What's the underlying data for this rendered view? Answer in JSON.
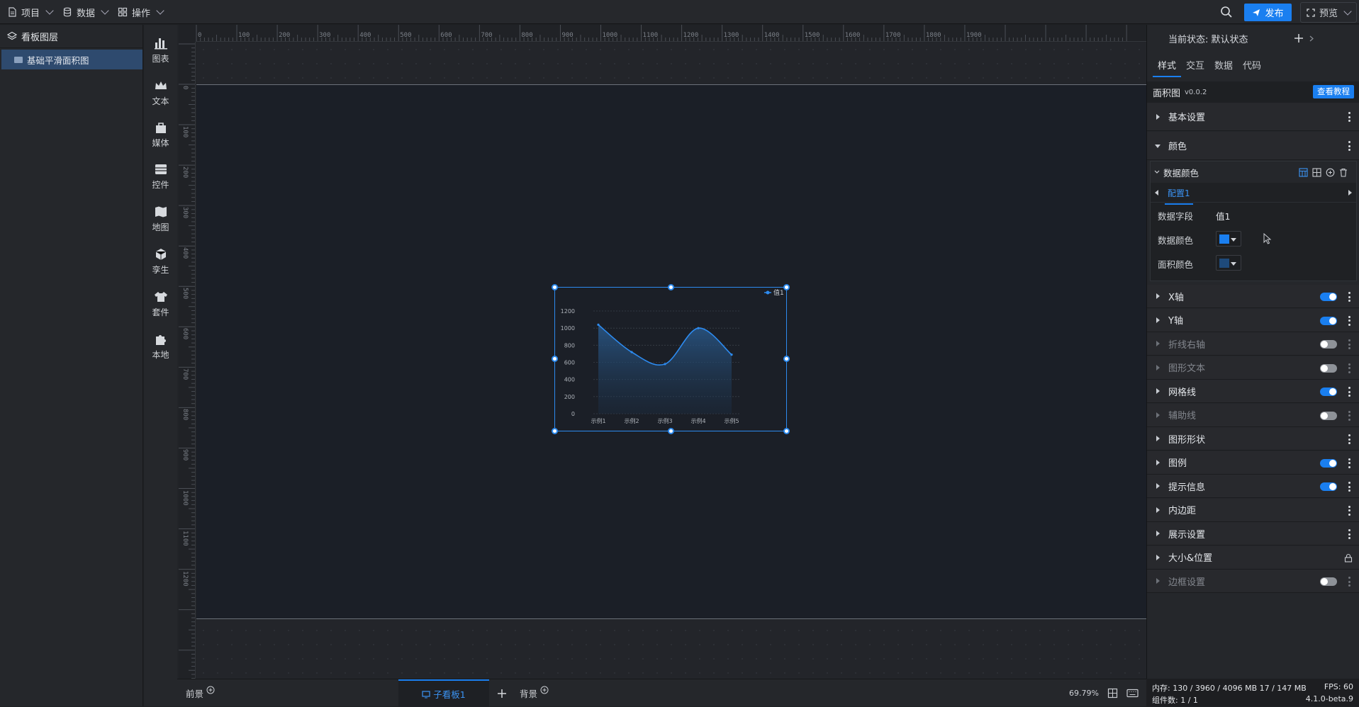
{
  "topbar": {
    "menus": [
      "项目",
      "数据",
      "操作"
    ],
    "publish_label": "发布",
    "preview_label": "预览"
  },
  "layers": {
    "title": "看板图层",
    "items": [
      "基础平滑面积图"
    ]
  },
  "toolbox": [
    "图表",
    "文本",
    "媒体",
    "控件",
    "地图",
    "孪生",
    "套件",
    "本地"
  ],
  "ruler": {
    "top": [
      "0",
      "100",
      "200",
      "300",
      "400",
      "500",
      "600",
      "700",
      "800",
      "900",
      "1000",
      "1100",
      "1200",
      "1300",
      "1400",
      "1500",
      "1600",
      "1700",
      "1800",
      "1900"
    ],
    "left": [
      "0",
      "100",
      "200",
      "300",
      "400",
      "500",
      "600",
      "700",
      "800",
      "900",
      "1000",
      "1100",
      "1200"
    ]
  },
  "bottom": {
    "tabs": [
      "前景",
      "子看板1",
      "背景"
    ],
    "zoom": "69.79%"
  },
  "panel": {
    "state_label": "当前状态: 默认状态",
    "tabs": [
      "样式",
      "交互",
      "数据",
      "代码"
    ],
    "component_name": "面积图",
    "component_version": "v0.0.2",
    "tutorial_label": "查看教程",
    "sections": [
      {
        "label": "基本设置",
        "toggle": null,
        "dim": false
      },
      {
        "label": "颜色",
        "toggle": null,
        "dim": false,
        "open": true
      },
      {
        "label": "X轴",
        "toggle": true,
        "dim": false
      },
      {
        "label": "Y轴",
        "toggle": true,
        "dim": false
      },
      {
        "label": "折线右轴",
        "toggle": false,
        "dim": true
      },
      {
        "label": "图形文本",
        "toggle": false,
        "dim": true
      },
      {
        "label": "网格线",
        "toggle": true,
        "dim": false
      },
      {
        "label": "辅助线",
        "toggle": false,
        "dim": true
      },
      {
        "label": "图形形状",
        "toggle": null,
        "dim": false
      },
      {
        "label": "图例",
        "toggle": true,
        "dim": false
      },
      {
        "label": "提示信息",
        "toggle": true,
        "dim": false
      },
      {
        "label": "内边距",
        "toggle": null,
        "dim": false
      },
      {
        "label": "展示设置",
        "toggle": null,
        "dim": false
      },
      {
        "label": "大小&位置",
        "toggle": null,
        "dim": false,
        "lock": true
      },
      {
        "label": "边框设置",
        "toggle": false,
        "dim": true
      }
    ],
    "data_color": {
      "title": "数据颜色",
      "config_tab": "配置1",
      "field_label": "数据字段",
      "field_value": "值1",
      "color_label": "数据颜色",
      "area_label": "面积颜色",
      "colors": {
        "data": "#1a7ff0",
        "area": "#1e4a7a"
      }
    }
  },
  "status": {
    "memory": "内存: 130 / 3960 / 4096 MB  17 / 147 MB",
    "fps": "FPS: 60",
    "components": "组件数: 1 / 1",
    "version": "4.1.0-beta.9"
  },
  "chart_data": {
    "type": "area",
    "categories": [
      "示例1",
      "示例2",
      "示例3",
      "示例4",
      "示例5"
    ],
    "series": [
      {
        "name": "值1",
        "values": [
          1040,
          720,
          580,
          1000,
          690
        ]
      }
    ],
    "ylim": [
      0,
      1200
    ],
    "yticks": [
      "0",
      "200",
      "400",
      "600",
      "800",
      "1000",
      "1200"
    ],
    "grid": true,
    "legend": "top-right",
    "color": "#2d8bf0"
  }
}
